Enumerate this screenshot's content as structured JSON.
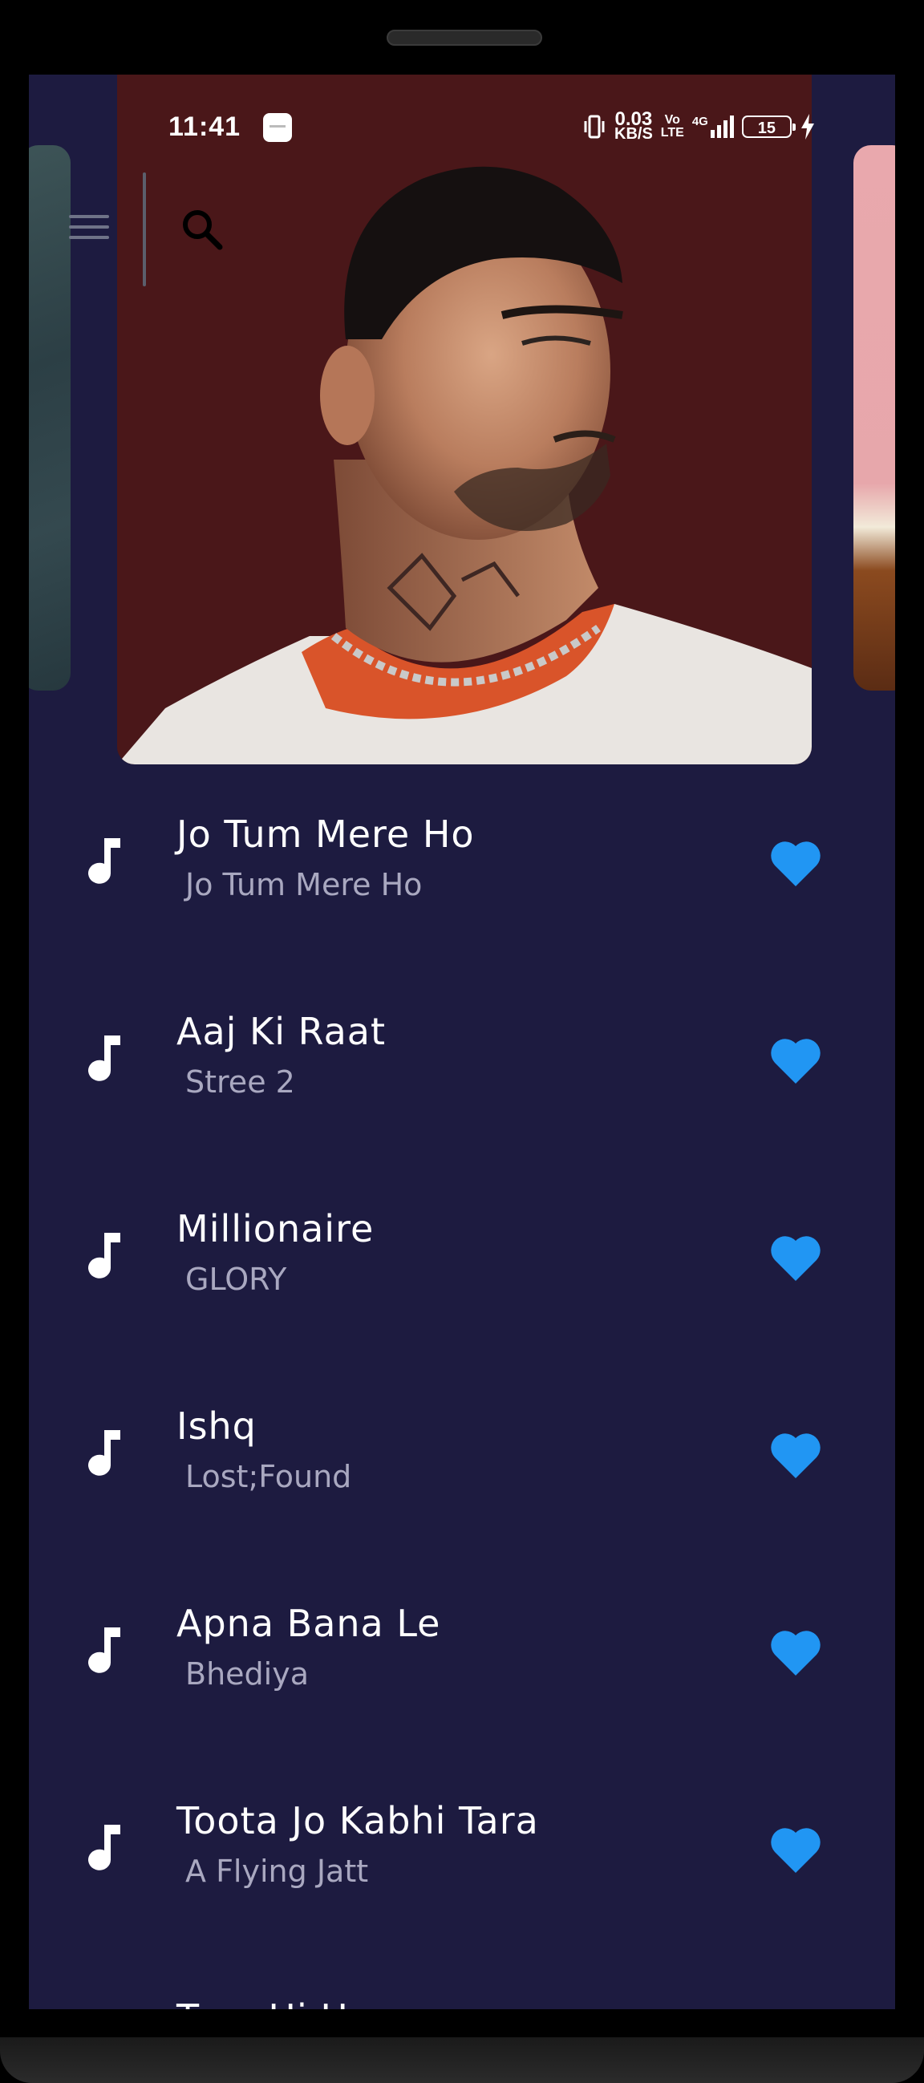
{
  "status_bar": {
    "time": "11:41",
    "net_speed_value": "0.03",
    "net_speed_unit": "KB/S",
    "volte_top": "Vo",
    "volte_bottom": "LTE",
    "network": "4G",
    "battery": "15"
  },
  "colors": {
    "background": "#1d1b40",
    "heart": "#2196f3",
    "title_text": "#ffffff",
    "subtitle_text": "#a9a8c0",
    "featured_card_bg": "#4a1719"
  },
  "icons": {
    "menu": "menu-icon",
    "search": "search-icon",
    "song": "music-note-icon",
    "favorite": "heart-icon"
  },
  "songs": [
    {
      "title": "Jo Tum Mere Ho",
      "subtitle": "Jo Tum Mere Ho"
    },
    {
      "title": "Aaj Ki Raat",
      "subtitle": "Stree 2"
    },
    {
      "title": "Millionaire",
      "subtitle": "GLORY"
    },
    {
      "title": "Ishq",
      "subtitle": "Lost;Found"
    },
    {
      "title": "Apna Bana Le",
      "subtitle": "Bhediya"
    },
    {
      "title": "Toota Jo Kabhi Tara",
      "subtitle": "A Flying Jatt"
    }
  ],
  "partial_next_title": "Tere Hi Hum"
}
